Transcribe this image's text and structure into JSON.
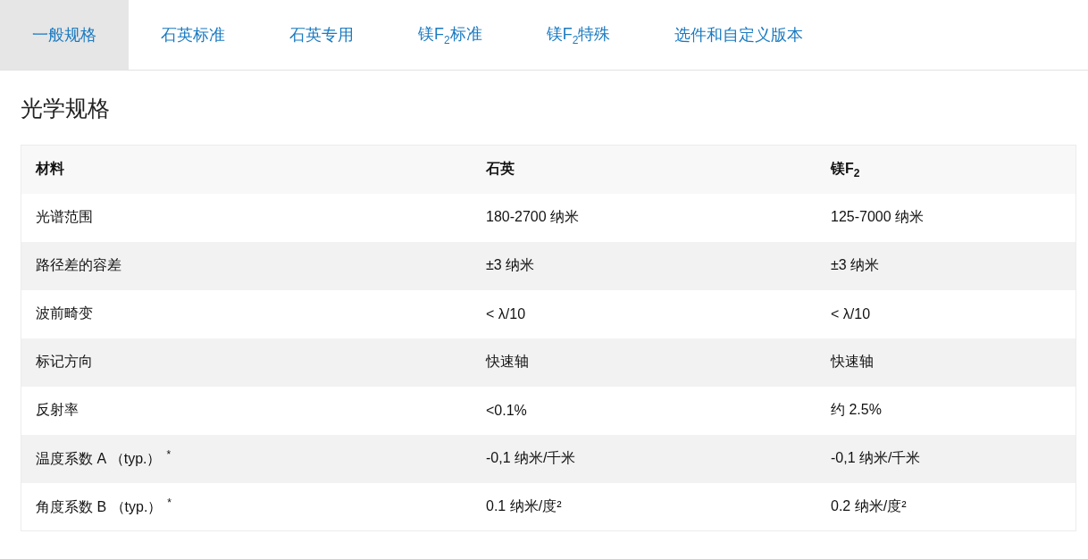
{
  "tabs": [
    {
      "label": "一般规格",
      "selected": true
    },
    {
      "label": "石英标准",
      "selected": false
    },
    {
      "label": "石英专用",
      "selected": false
    },
    {
      "label": "镁F$_{2}$标准",
      "selected": false
    },
    {
      "label": "镁F$_{2}$特殊",
      "selected": false
    },
    {
      "label": "选件和自定义版本",
      "selected": false
    }
  ],
  "section_title": "光学规格",
  "table": {
    "columns": [
      "材料",
      "石英",
      "镁F$_{2}$"
    ],
    "rows": [
      [
        "光谱范围",
        "180-2700 纳米",
        "125-7000 纳米"
      ],
      [
        "路径差的容差",
        "±3 纳米",
        "±3 纳米"
      ],
      [
        "波前畸变",
        "< λ/10",
        "< λ/10"
      ],
      [
        "标记方向",
        "快速轴",
        "快速轴"
      ],
      [
        "反射率",
        "<0.1%",
        "约 2.5%"
      ],
      [
        "温度系数 A （typ.）$^{*}$",
        "-0,1 纳米/千米",
        "-0,1 纳米/千米"
      ],
      [
        "角度系数 B （typ.）$^{*}$",
        "0.1 纳米/度²",
        "0.2 纳米/度²"
      ]
    ]
  }
}
